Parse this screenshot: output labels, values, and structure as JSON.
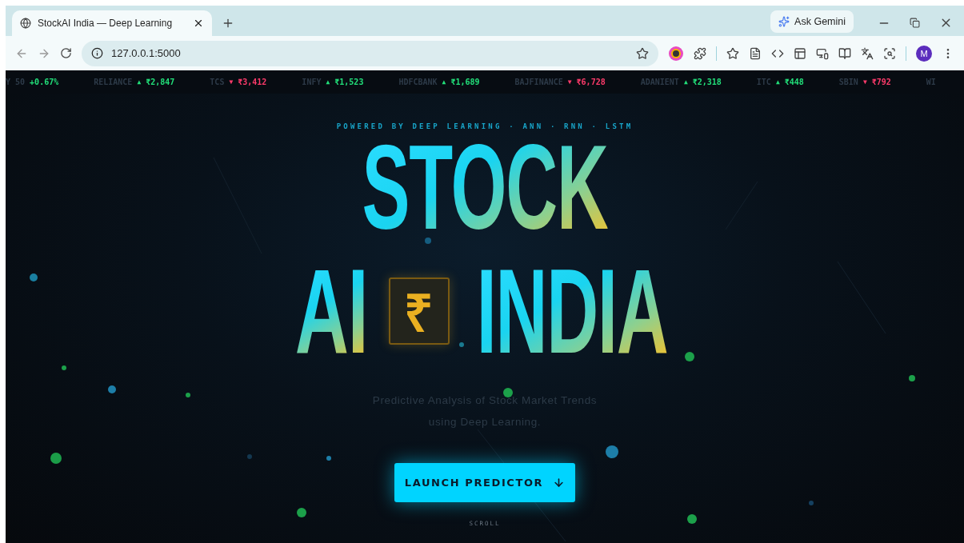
{
  "browser": {
    "tab": {
      "title": "StockAI India — Deep Learning",
      "selected": true
    },
    "ask_button": "Ask Gemini",
    "url": "127.0.0.1:5000",
    "profile_initial": "M"
  },
  "ticker": [
    {
      "symbol": "Y 50",
      "price": "+0.67%",
      "color": "#22e07a"
    },
    {
      "symbol": "RELIANCE",
      "arrow": "▲",
      "price": "₹2,847",
      "color": "#22e07a"
    },
    {
      "symbol": "TCS",
      "arrow": "▼",
      "price": "₹3,412",
      "color": "#ff3b6b"
    },
    {
      "symbol": "INFY",
      "arrow": "▲",
      "price": "₹1,523",
      "color": "#22e07a"
    },
    {
      "symbol": "HDFCBANK",
      "arrow": "▲",
      "price": "₹1,689",
      "color": "#22e07a"
    },
    {
      "symbol": "BAJFINANCE",
      "arrow": "▼",
      "price": "₹6,728",
      "color": "#ff3b6b"
    },
    {
      "symbol": "ADANIENT",
      "arrow": "▲",
      "price": "₹2,318",
      "color": "#22e07a"
    },
    {
      "symbol": "ITC",
      "arrow": "▲",
      "price": "₹448",
      "color": "#22e07a"
    },
    {
      "symbol": "SBIN",
      "arrow": "▼",
      "price": "₹792",
      "color": "#ff3b6b"
    },
    {
      "symbol": "WI"
    }
  ],
  "hero": {
    "eyebrow": "POWERED BY DEEP LEARNING · ANN · RNN · LSTM",
    "title_line_1": "STOCK",
    "title_word_left": "AI",
    "currency_symbol": "₹",
    "title_word_right": "INDIA",
    "subtitle": "Predictive Analysis of Stock Market Trends using Deep Learning.",
    "cta": "LAUNCH PREDICTOR",
    "scroll_hint": "SCROLL"
  }
}
